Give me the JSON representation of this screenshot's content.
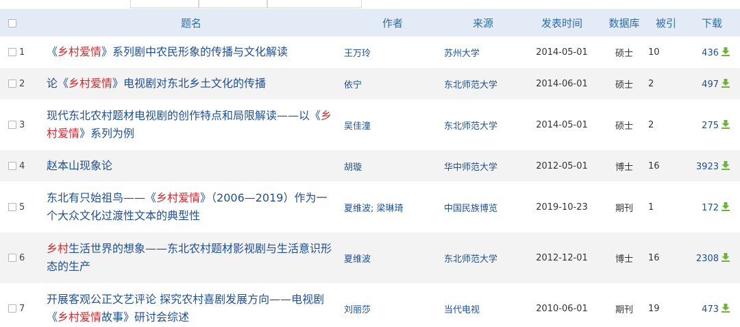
{
  "header": {
    "title": "题名",
    "author": "作者",
    "source": "来源",
    "date": "发表时间",
    "database": "数据库",
    "cited": "被引",
    "download": "下载"
  },
  "rows": [
    {
      "num": "1",
      "title_parts": [
        {
          "text": "《",
          "hl": false
        },
        {
          "text": "乡村爱情",
          "hl": true
        },
        {
          "text": "》系列剧中农民形象的传播与文化解读",
          "hl": false
        }
      ],
      "author": "王万玲",
      "source": "苏州大学",
      "date": "2014-05-01",
      "database": "硕士",
      "cited": "10",
      "downloads": "436"
    },
    {
      "num": "2",
      "title_parts": [
        {
          "text": "论《",
          "hl": false
        },
        {
          "text": "乡村爱情",
          "hl": true
        },
        {
          "text": "》电视剧对东北乡土文化的传播",
          "hl": false
        }
      ],
      "author": "依宁",
      "source": "东北师范大学",
      "date": "2014-06-01",
      "database": "硕士",
      "cited": "2",
      "downloads": "497"
    },
    {
      "num": "3",
      "title_parts": [
        {
          "text": "现代东北农村题材电视剧的创作特点和局限解读——以《",
          "hl": false
        },
        {
          "text": "乡村爱情",
          "hl": true
        },
        {
          "text": "》系列为例",
          "hl": false
        }
      ],
      "author": "吴佳潼",
      "source": "东北师范大学",
      "date": "2014-05-01",
      "database": "硕士",
      "cited": "2",
      "downloads": "275"
    },
    {
      "num": "4",
      "title_parts": [
        {
          "text": "赵本山现象论",
          "hl": false
        }
      ],
      "author": "胡璇",
      "source": "华中师范大学",
      "date": "2012-05-01",
      "database": "博士",
      "cited": "16",
      "downloads": "3923"
    },
    {
      "num": "5",
      "title_parts": [
        {
          "text": "东北有只始祖鸟——《",
          "hl": false
        },
        {
          "text": "乡村爱情",
          "hl": true
        },
        {
          "text": "》（2006—2019）作为一个大众文化过渡性文本的典型性",
          "hl": false
        }
      ],
      "author": "夏维波; 梁琳琦",
      "source": "中国民族博览",
      "date": "2019-10-23",
      "database": "期刊",
      "cited": "1",
      "downloads": "172"
    },
    {
      "num": "6",
      "title_parts": [
        {
          "text": "乡村",
          "hl": true
        },
        {
          "text": "生活世界的想象——东北农村题材影视剧与生活意识形态的生产",
          "hl": false
        }
      ],
      "author": "夏维波",
      "source": "东北师范大学",
      "date": "2012-12-01",
      "database": "博士",
      "cited": "16",
      "downloads": "2308"
    },
    {
      "num": "7",
      "title_parts": [
        {
          "text": "开展客观公正文艺评论 探究农村喜剧发展方向——电视剧《",
          "hl": false
        },
        {
          "text": "乡村爱情",
          "hl": true
        },
        {
          "text": "故事》研讨会综述",
          "hl": false
        }
      ],
      "author": "刘丽莎",
      "source": "当代电视",
      "date": "2010-06-01",
      "database": "期刊",
      "cited": "19",
      "downloads": "473"
    }
  ],
  "colors": {
    "header_bg": "#e3ecf6",
    "header_text": "#2d6bb5",
    "link": "#1d4f99",
    "highlight": "#d6262e",
    "download_icon": "#6fb33a",
    "alt_row": "#f3f3f3"
  },
  "icons": {
    "download": "download-arrow-icon",
    "checkbox": "checkbox-icon"
  }
}
